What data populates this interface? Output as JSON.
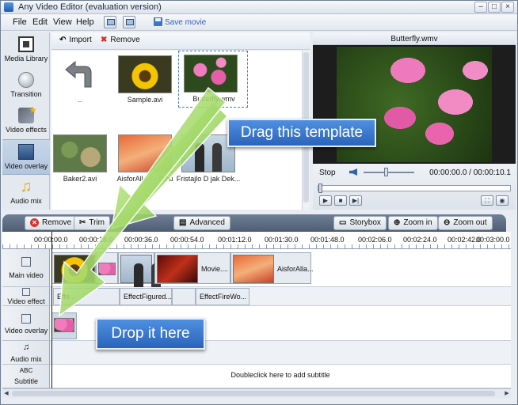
{
  "window": {
    "title": "Any Video Editor (evaluation version)",
    "controls": [
      "–",
      "□",
      "×"
    ]
  },
  "menu": {
    "items": [
      "File",
      "Edit",
      "View",
      "Help"
    ],
    "save_label": "Save movie"
  },
  "sidebar": {
    "items": [
      {
        "label": "Media Library",
        "icon": "film-icon"
      },
      {
        "label": "Transition",
        "icon": "transition-orb-icon"
      },
      {
        "label": "Video effects",
        "icon": "magic-star-icon"
      },
      {
        "label": "Video overlay",
        "icon": "overlay-film-icon",
        "active": true
      },
      {
        "label": "Audio mix",
        "icon": "music-note-icon"
      }
    ]
  },
  "library": {
    "import_label": "Import",
    "remove_label": "Remove",
    "up_label": "..",
    "clips": [
      {
        "name": "Sample.avi",
        "thumb": "sunflower"
      },
      {
        "name": "Butterfly.wmv",
        "thumb": "pink-flowers",
        "selected": true
      },
      {
        "name": "Baker2.avi",
        "thumb": "aerial-map"
      },
      {
        "name": "AisforAllaboutYou",
        "thumb": "orange-abstract"
      },
      {
        "name": "Fristajlo D jak Dek...",
        "thumb": "two-people"
      }
    ]
  },
  "preview": {
    "title": "Butterfly.wmv",
    "status": "Stop",
    "timecode": "00:00:00.0 / 00:00:10.1",
    "volume": 0.45,
    "progress": 0.0
  },
  "timeline": {
    "toolbar": {
      "remove": "Remove",
      "trim": "Trim",
      "advanced": "Advanced",
      "storybox": "Storybox",
      "zoom_in": "Zoom in",
      "zoom_out": "Zoom out"
    },
    "ruler": [
      "00:00:00.0",
      "00:00:18.0",
      "00:00:36.0",
      "00:00:54.0",
      "00:01:12.0",
      "00:01:30.0",
      "00:01:48.0",
      "00:02:06.0",
      "00:02:24.0",
      "00:02:42.0",
      "00:03:00.0"
    ],
    "tracks": {
      "main_video": "Main video",
      "video_effect": "Video effect",
      "video_overlay": "Video overlay",
      "audio_mix": "Audio mix",
      "subtitle": "Subtitle"
    },
    "main_clips": [
      {
        "name": "",
        "thumb": "sunflower"
      },
      {
        "name": "",
        "thumb": "pink-flowers"
      },
      {
        "name": "",
        "thumb": "two-people"
      },
      {
        "name": "Movie....",
        "thumb": "fire"
      },
      {
        "name": "AisforAlla...",
        "thumb": "orange-abstract"
      }
    ],
    "effects": [
      "Effe...",
      "EffectFigured...",
      "EffectFireWo..."
    ],
    "subtitle_hint": "Doubleclick here to add subtitle",
    "subtitle_abc": "ABC"
  },
  "callouts": {
    "drag": "Drag this template",
    "drop": "Drop it here"
  },
  "colors": {
    "accent": "#2a64bb",
    "arrow_green": "#8fd14f",
    "toolbar_dark": "#4e5d72"
  }
}
